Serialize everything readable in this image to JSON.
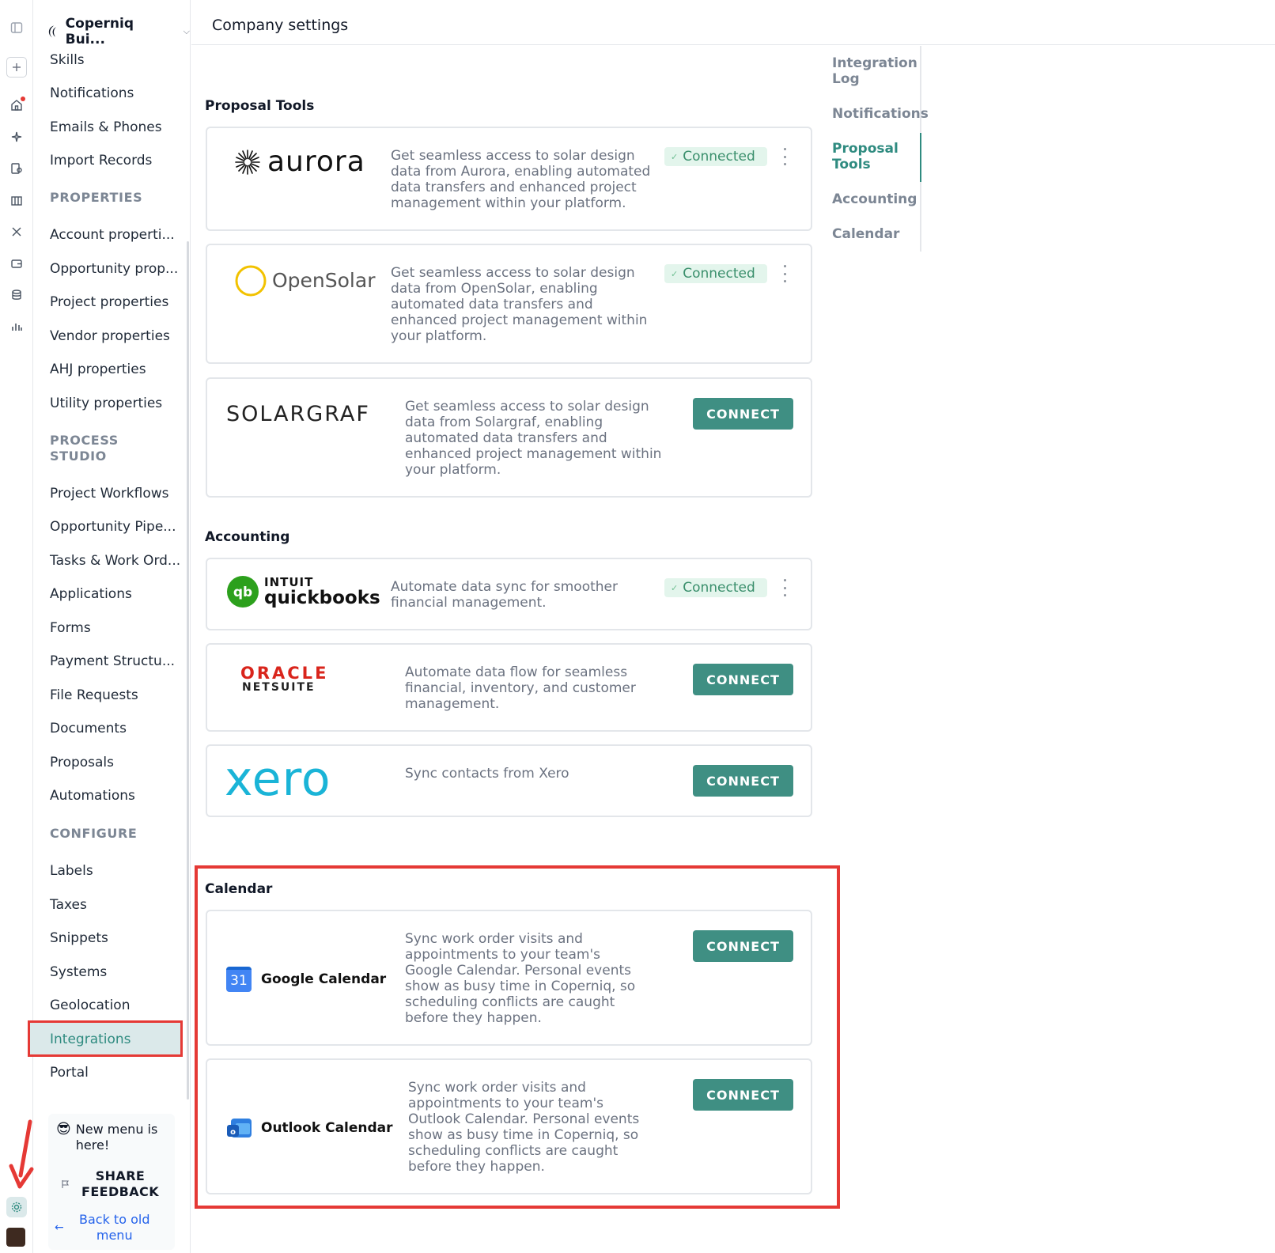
{
  "workspace": {
    "name": "Coperniq Bui..."
  },
  "header": {
    "title": "Company settings"
  },
  "sidebar": {
    "items_top": [
      "Skills",
      "Notifications",
      "Emails & Phones",
      "Import Records"
    ],
    "properties_heading": "PROPERTIES",
    "properties": [
      "Account properti...",
      "Opportunity prop...",
      "Project properties",
      "Vendor properties",
      "AHJ properties",
      "Utility properties"
    ],
    "process_heading": "PROCESS STUDIO",
    "process": [
      "Project Workflows",
      "Opportunity Pipe...",
      "Tasks & Work Ord...",
      "Applications",
      "Forms",
      "Payment Structu...",
      "File Requests",
      "Documents",
      "Proposals",
      "Automations"
    ],
    "configure_heading": "CONFIGURE",
    "configure": [
      "Labels",
      "Taxes",
      "Snippets",
      "Systems",
      "Geolocation",
      "Integrations",
      "Portal"
    ],
    "active": "Integrations"
  },
  "promo": {
    "emoji": "😎",
    "message": "New menu is here!",
    "feedback_label": "SHARE FEEDBACK",
    "back_label": "Back to old menu"
  },
  "anchors": [
    {
      "label": "Integration Log",
      "active": false
    },
    {
      "label": "Notifications",
      "active": false
    },
    {
      "label": "Proposal Tools",
      "active": true
    },
    {
      "label": "Accounting",
      "active": false
    },
    {
      "label": "Calendar",
      "active": false
    }
  ],
  "sections": {
    "proposal_tools": {
      "title": "Proposal Tools",
      "integrations": [
        {
          "name": "aurora",
          "description": "Get seamless access to solar design data from Aurora, enabling automated data transfers and enhanced project management within your platform.",
          "status": "Connected"
        },
        {
          "name": "OpenSolar",
          "description": "Get seamless access to solar design data from OpenSolar, enabling automated data transfers and enhanced project management within your platform.",
          "status": "Connected"
        },
        {
          "name": "SOLARGRAF",
          "description": "Get seamless access to solar design data from Solargraf, enabling automated data transfers and enhanced project management within your platform.",
          "action": "CONNECT"
        }
      ]
    },
    "accounting": {
      "title": "Accounting",
      "integrations": [
        {
          "name_top": "INTUIT",
          "name_bottom": "quickbooks",
          "description": "Automate data sync for smoother financial management.",
          "status": "Connected"
        },
        {
          "name_top": "ORACLE",
          "name_bottom": "NETSUITE",
          "description": "Automate data flow for seamless financial, inventory, and customer management.",
          "action": "CONNECT"
        },
        {
          "name": "xero",
          "description": "Sync contacts from Xero",
          "action": "CONNECT"
        }
      ]
    },
    "calendar": {
      "title": "Calendar",
      "integrations": [
        {
          "name": "Google Calendar",
          "icon_text": "31",
          "description": "Sync work order visits and appointments to your team's Google Calendar. Personal events show as busy time in Coperniq, so scheduling conflicts are caught before they happen.",
          "action": "CONNECT"
        },
        {
          "name": "Outlook Calendar",
          "description": "Sync work order visits and appointments to your team's Outlook Calendar. Personal events show as busy time in Coperniq, so scheduling conflicts are caught before they happen.",
          "action": "CONNECT"
        }
      ]
    }
  },
  "colors": {
    "accent": "#2f8b80",
    "connect_button": "#3f8f83",
    "connected_badge_bg": "#e3f5ec",
    "highlight": "#e53935"
  }
}
